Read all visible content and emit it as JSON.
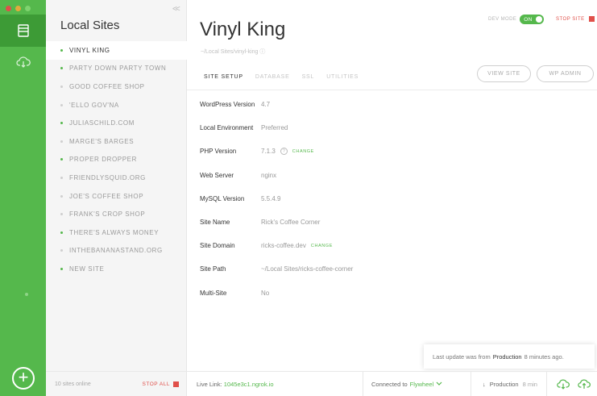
{
  "window": {
    "traffic_colors": [
      "#e0504a",
      "#e3a93e",
      "#55b84c"
    ]
  },
  "colors": {
    "brand_green": "#55b84c",
    "stop_red": "#e0504a"
  },
  "sidebar": {
    "title": "Local Sites",
    "items": [
      {
        "label": "VINYL KING",
        "running": true,
        "active": true
      },
      {
        "label": "PARTY DOWN PARTY TOWN",
        "running": true,
        "active": false
      },
      {
        "label": "GOOD COFFEE SHOP",
        "running": false,
        "active": false
      },
      {
        "label": "'ELLO GOV'NA",
        "running": false,
        "active": false
      },
      {
        "label": "JULIASCHILD.COM",
        "running": true,
        "active": false
      },
      {
        "label": "MARGE'S BARGES",
        "running": false,
        "active": false
      },
      {
        "label": "PROPER DROPPER",
        "running": true,
        "active": false
      },
      {
        "label": "FRIENDLYSQUID.ORG",
        "running": false,
        "active": false
      },
      {
        "label": "JOE'S COFFEE SHOP",
        "running": false,
        "active": false
      },
      {
        "label": "FRANK'S CROP SHOP",
        "running": false,
        "active": false
      },
      {
        "label": "THERE'S ALWAYS MONEY",
        "running": true,
        "active": false
      },
      {
        "label": "INTHEBANANASTAND.ORG",
        "running": false,
        "active": false
      },
      {
        "label": "NEW SITE",
        "running": true,
        "active": false
      }
    ],
    "sites_online": "10 sites online",
    "stop_all": "STOP ALL"
  },
  "header": {
    "site_name": "Vinyl King",
    "site_path": "~/Local Sites/vinyl-king",
    "dev_mode_label": "DEV MODE",
    "toggle_label": "ON",
    "stop_site": "STOP SITE"
  },
  "tabs": [
    {
      "label": "SITE SETUP",
      "active": true
    },
    {
      "label": "DATABASE",
      "active": false
    },
    {
      "label": "SSL",
      "active": false
    },
    {
      "label": "UTILITIES",
      "active": false
    }
  ],
  "buttons": {
    "view_site": "VIEW SITE",
    "wp_admin": "WP ADMIN"
  },
  "info": [
    {
      "label": "WordPress Version",
      "value": "4.7"
    },
    {
      "label": "Local Environment",
      "value": "Preferred"
    },
    {
      "label": "PHP Version",
      "value": "7.1.3",
      "help": "?",
      "action": "CHANGE"
    },
    {
      "label": "Web Server",
      "value": "nginx"
    },
    {
      "label": "MySQL Version",
      "value": "5.5.4.9"
    },
    {
      "label": "Site Name",
      "value": "Rick's Coffee Corner"
    },
    {
      "label": "Site Domain",
      "value": "ricks-coffee.dev",
      "action": "CHANGE"
    },
    {
      "label": "Site Path",
      "value": "~/Local Sites/ricks-coffee-corner"
    },
    {
      "label": "Multi-Site",
      "value": "No"
    }
  ],
  "toast": {
    "prefix": "Last update was from",
    "source": "Production",
    "suffix": "8 minutes ago."
  },
  "footer": {
    "live_link_label": "Live Link:",
    "live_link_url": "1045e3c1.ngrok.io",
    "connected_label": "Connected to",
    "connected_service": "Flywheel",
    "env_name": "Production",
    "env_time": "8 min"
  }
}
